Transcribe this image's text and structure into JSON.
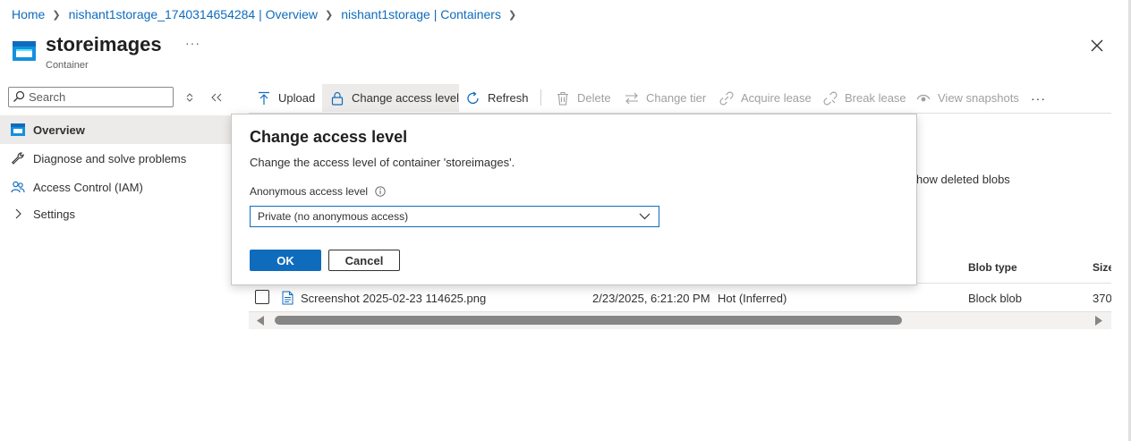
{
  "breadcrumb": [
    {
      "label": "Home"
    },
    {
      "label": "nishant1storage_1740314654284 | Overview"
    },
    {
      "label": "nishant1storage | Containers"
    }
  ],
  "header": {
    "title": "storeimages",
    "subtitle": "Container",
    "more": "···"
  },
  "search": {
    "placeholder": "Search"
  },
  "sidebar": {
    "items": [
      {
        "label": "Overview",
        "icon": "container-icon",
        "active": true
      },
      {
        "label": "Diagnose and solve problems",
        "icon": "wrench-icon"
      },
      {
        "label": "Access Control (IAM)",
        "icon": "people-icon"
      },
      {
        "label": "Settings",
        "icon": "chevron-right-icon"
      }
    ]
  },
  "toolbar": {
    "upload": "Upload",
    "change_access": "Change access level",
    "refresh": "Refresh",
    "delete": "Delete",
    "change_tier": "Change tier",
    "acquire_lease": "Acquire lease",
    "break_lease": "Break lease",
    "view_snapshots": "View snapshots",
    "more": "···"
  },
  "list": {
    "show_deleted": "how deleted blobs",
    "columns": {
      "blob_type": "Blob type",
      "size": "Size"
    },
    "rows": [
      {
        "name": "Screenshot 2025-02-23 114625.png",
        "modified": "2/23/2025, 6:21:20 PM",
        "tier": "Hot (Inferred)",
        "blob_type": "Block blob",
        "size": "370"
      }
    ]
  },
  "dialog": {
    "title": "Change access level",
    "description": "Change the access level of container 'storeimages'.",
    "label": "Anonymous access level",
    "selected": "Private (no anonymous access)",
    "ok": "OK",
    "cancel": "Cancel"
  },
  "colors": {
    "accent": "#0f6cbd",
    "text": "#323130",
    "disabled": "#a19f9d"
  }
}
